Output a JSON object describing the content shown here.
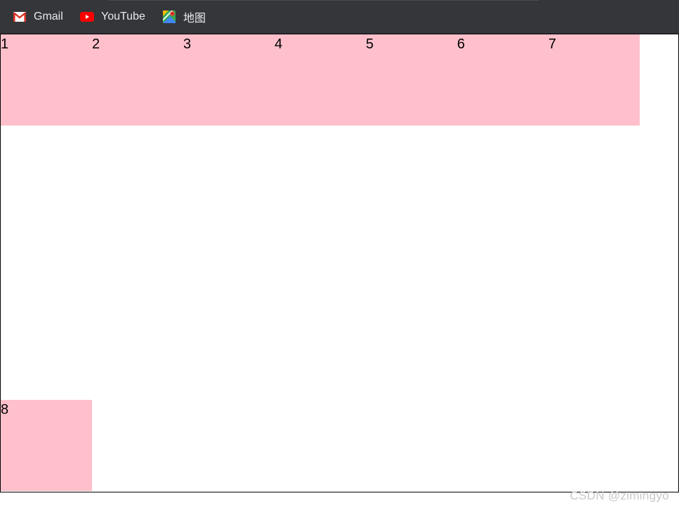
{
  "bookmarks": [
    {
      "label": "Gmail",
      "icon": "gmail-icon"
    },
    {
      "label": "YouTube",
      "icon": "youtube-icon"
    },
    {
      "label": "地图",
      "icon": "maps-icon"
    }
  ],
  "boxes": {
    "row": [
      "1",
      "2",
      "3",
      "4",
      "5",
      "6",
      "7"
    ],
    "last": "8"
  },
  "colors": {
    "box_bg": "#ffc0cb",
    "bar_bg": "#35363a"
  },
  "watermark": "CSDN @zimingyo"
}
